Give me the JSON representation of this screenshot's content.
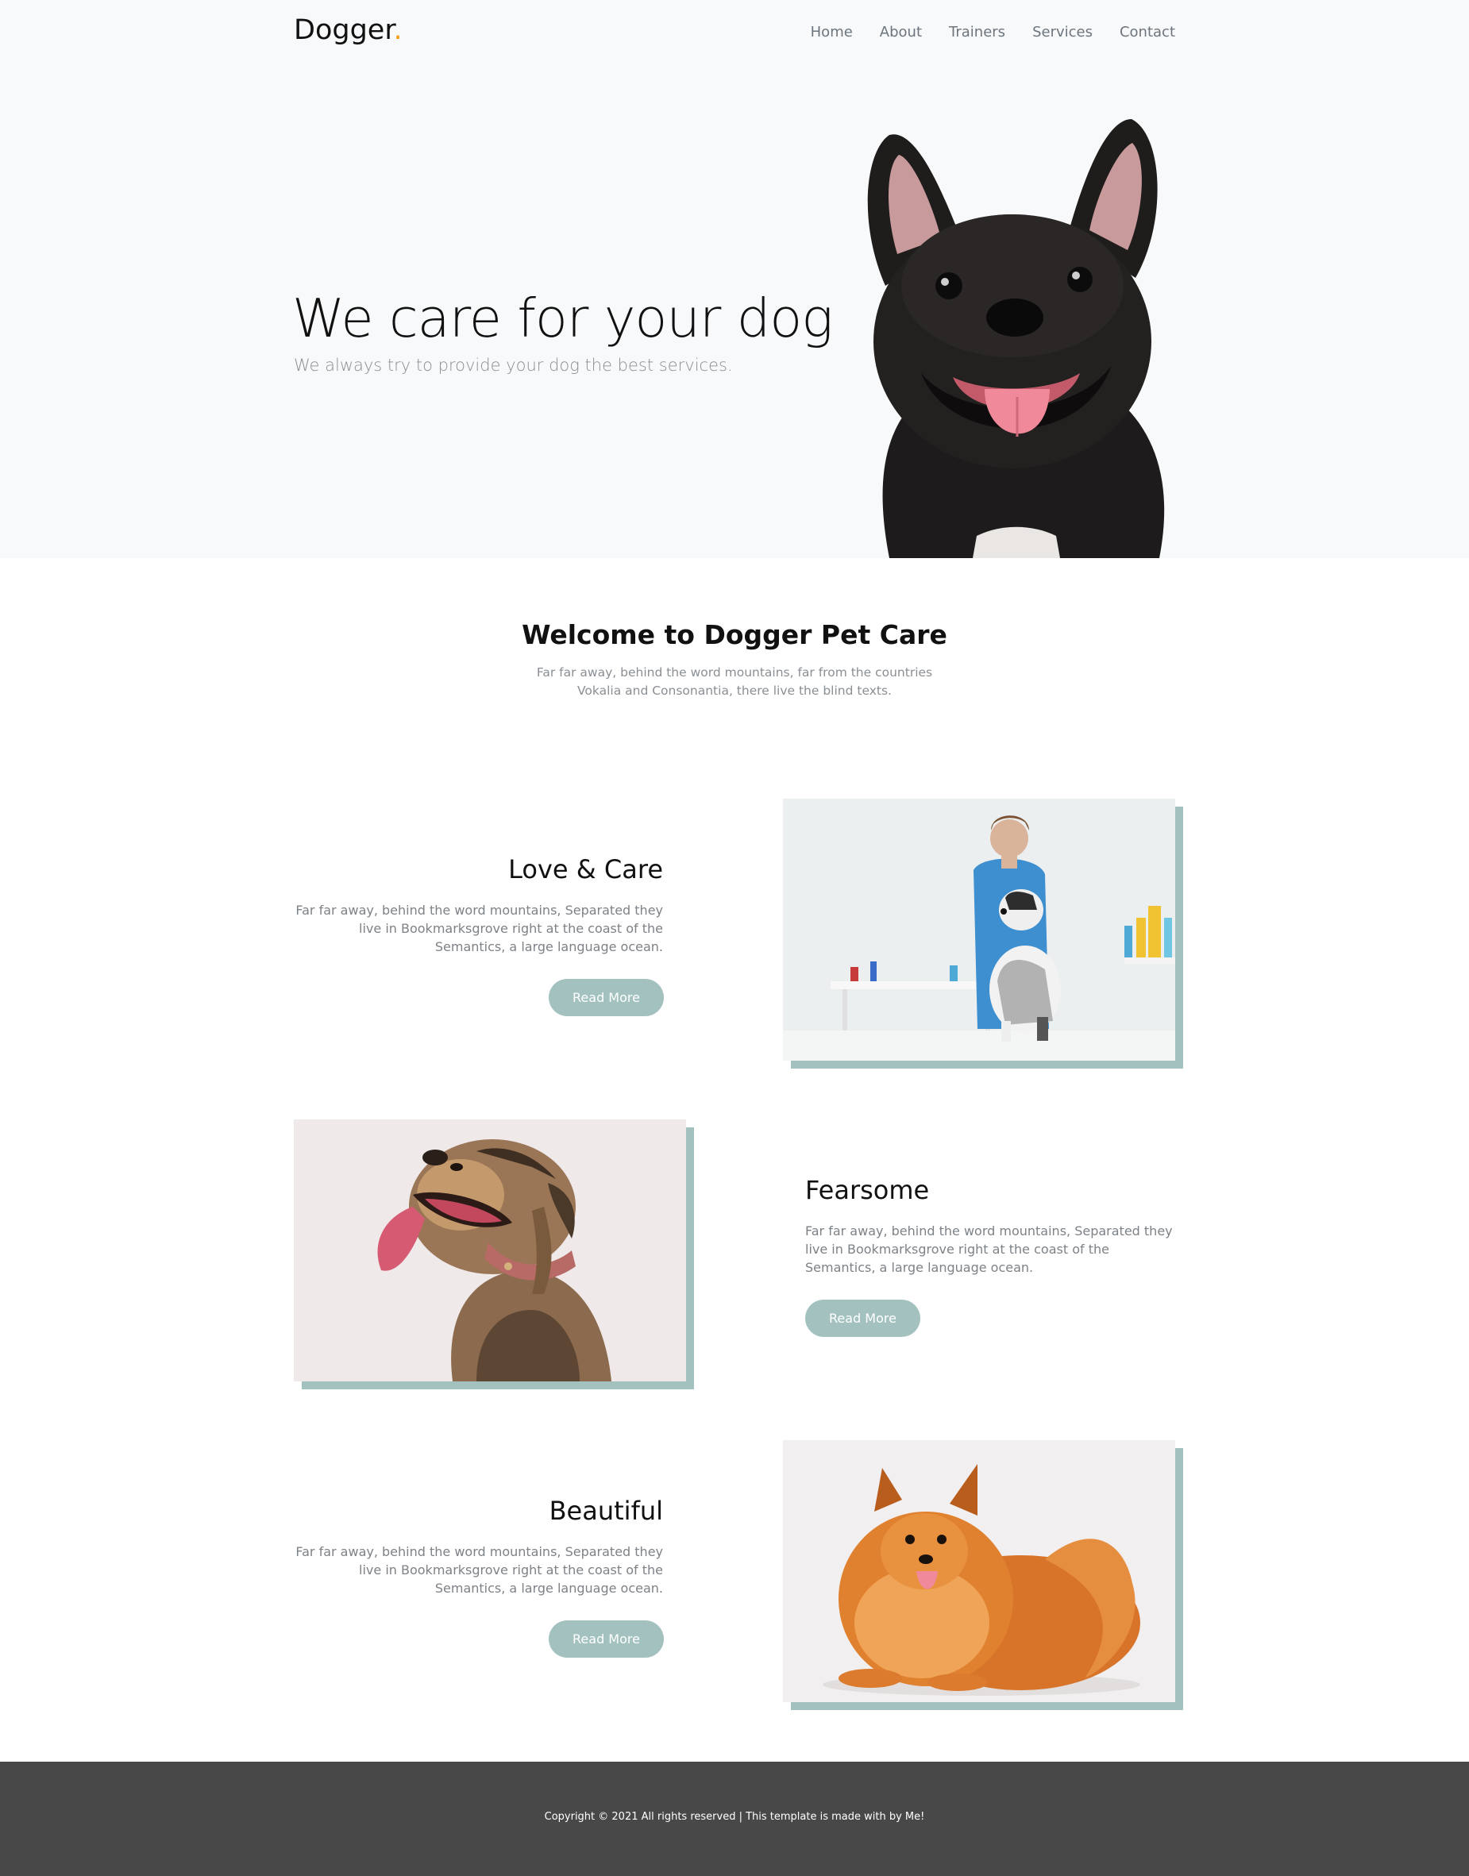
{
  "brand": {
    "name": "Dogger",
    "dot": ".",
    "accent": "#f89d13"
  },
  "nav": {
    "items": [
      "Home",
      "About",
      "Trainers",
      "Services",
      "Contact"
    ]
  },
  "hero": {
    "title": "We care for your dog",
    "subtitle": "We always try to provide your dog the best services."
  },
  "welcome": {
    "title": "Welcome to Dogger Pet Care",
    "text": "Far far away, behind the word mountains, far from the countries Vokalia and Consonantia, there live the blind texts."
  },
  "features": [
    {
      "title": "Love & Care",
      "text": "Far far away, behind the word mountains, Separated they live in Bookmarksgrove right at the coast of the Semantics, a large language ocean.",
      "button": "Read More"
    },
    {
      "title": "Fearsome",
      "text": "Far far away, behind the word mountains, Separated they live in Bookmarksgrove right at the coast of the Semantics, a large language ocean.",
      "button": "Read More"
    },
    {
      "title": "Beautiful",
      "text": "Far far away, behind the word mountains, Separated they live in Bookmarksgrove right at the coast of the Semantics, a large language ocean.",
      "button": "Read More"
    }
  ],
  "footer": {
    "text": "Copyright © 2021 All rights reserved | This template is made with by Me!"
  },
  "colors": {
    "button": "#a3c2bf",
    "footer": "#484848",
    "header_bg": "#f8f9fa"
  }
}
